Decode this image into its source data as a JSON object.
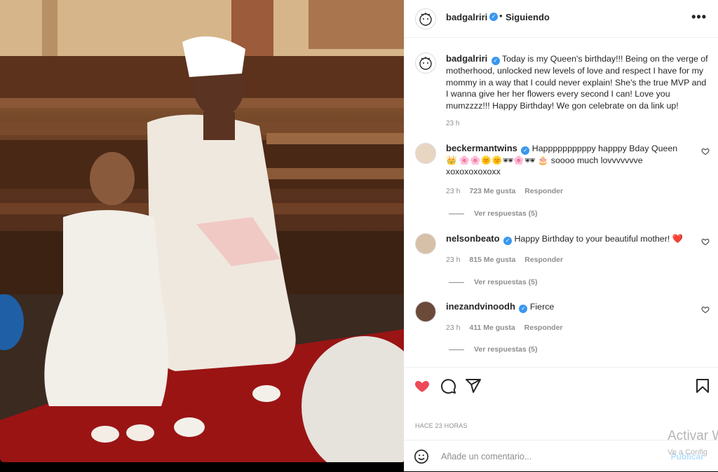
{
  "post": {
    "author": "badgalriri",
    "follow_status": "Siguiendo",
    "dot": "•",
    "more": "•••",
    "caption": "Today is my Queen's birthday!!! Being on the verge of motherhood, unlocked new levels of love and respect I have for my mommy in a way that I could never explain! She's the true MVP and I wanna give her her flowers every second I can! Love you mumzzzz!!! Happy Birthday! We gon celebrate on da link up!",
    "caption_time": "23 h",
    "posted_ago": "HACE 23 HORAS"
  },
  "comments": [
    {
      "user": "beckermantwins",
      "text": "Happppppppppy happpy Bday Queen 👑 🌸🌸🌞🌞🕶🌸🕶 🎂 soooo much lovvvvvvve xoxoxoxoxoxx",
      "time": "23 h",
      "likes": "723 Me gusta",
      "reply": "Responder",
      "view_replies": "Ver respuestas (5)"
    },
    {
      "user": "nelsonbeato",
      "text": "Happy Birthday to your beautiful mother! ❤️",
      "time": "23 h",
      "likes": "815 Me gusta",
      "reply": "Responder",
      "view_replies": "Ver respuestas (5)"
    },
    {
      "user": "inezandvinoodh",
      "text": "Fierce",
      "time": "23 h",
      "likes": "411 Me gusta",
      "reply": "Responder",
      "view_replies": "Ver respuestas (5)"
    }
  ],
  "actions": {
    "like_icon": "heart-filled-icon",
    "comment_icon": "comment-icon",
    "share_icon": "send-icon",
    "save_icon": "bookmark-icon",
    "like_color": "#ed4956"
  },
  "composer": {
    "placeholder": "Añade un comentario...",
    "publish": "Publicar"
  },
  "os_overlay": {
    "line1": "Activar W",
    "line2": "Ve a Config"
  }
}
